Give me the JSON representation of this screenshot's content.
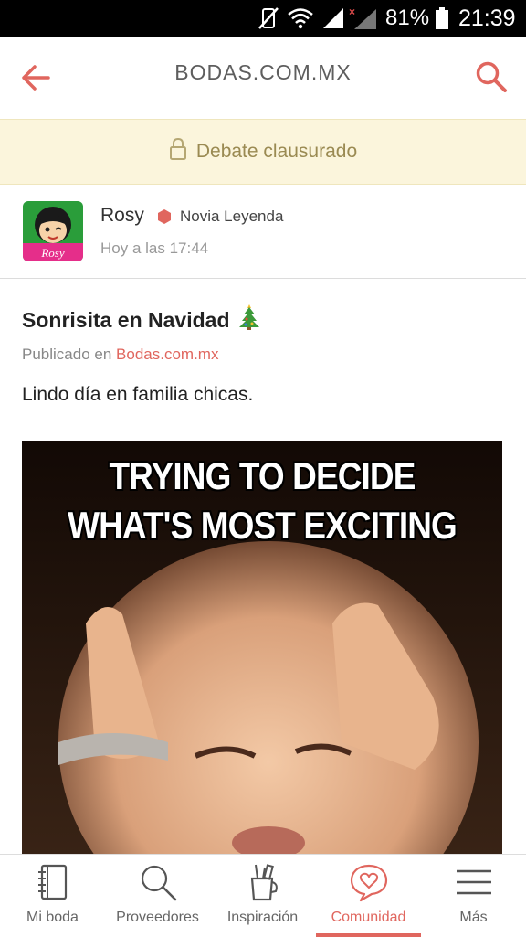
{
  "status_bar": {
    "battery": "81%",
    "time": "21:39"
  },
  "header": {
    "title": "BODAS.COM.MX"
  },
  "banner": {
    "text": "Debate clausurado"
  },
  "author": {
    "name": "Rosy",
    "rank": "Novia Leyenda",
    "time": "Hoy a las 17:44",
    "avatar_text": "Rosy"
  },
  "post": {
    "title": "Sonrisita en Navidad",
    "published_prefix": "Publicado en",
    "published_link": "Bodas.com.mx",
    "body": "Lindo día en familia chicas.",
    "image_caption_line1": "TRYING TO DECIDE",
    "image_caption_line2": "WHAT'S MOST EXCITING"
  },
  "bottom_nav": {
    "items": [
      {
        "label": "Mi boda",
        "icon": "notebook-icon"
      },
      {
        "label": "Proveedores",
        "icon": "search-icon"
      },
      {
        "label": "Inspiración",
        "icon": "pencil-cup-icon"
      },
      {
        "label": "Comunidad",
        "icon": "heart-chat-icon"
      },
      {
        "label": "Más",
        "icon": "menu-icon"
      }
    ],
    "active_index": 3
  },
  "colors": {
    "accent": "#e0665e",
    "banner_bg": "#fbf5dc",
    "banner_text": "#9a8a52"
  }
}
